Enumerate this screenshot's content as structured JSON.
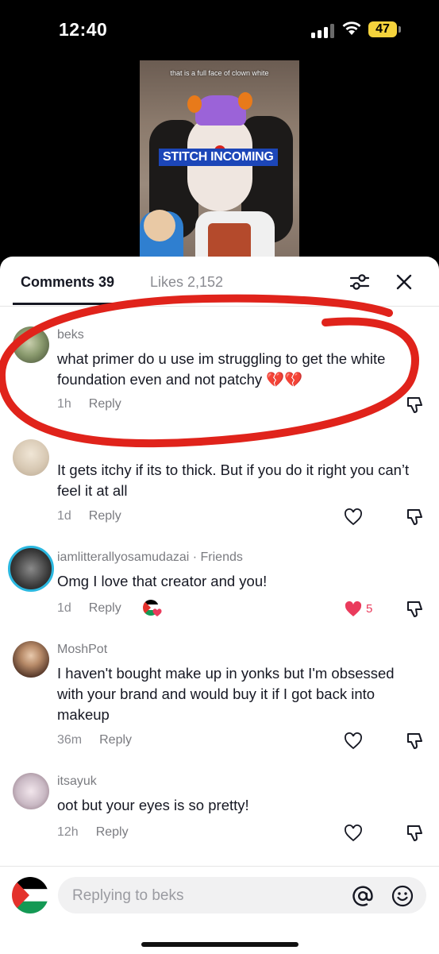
{
  "status_bar": {
    "time": "12:40",
    "battery": "47",
    "battery_color": "#f5d33c"
  },
  "video": {
    "caption": "that is a full face of clown white",
    "banner": "STITCH INCOMING"
  },
  "tabs": {
    "comments": "Comments 39",
    "likes": "Likes 2,152"
  },
  "comments": [
    {
      "user": "beks",
      "text": "what primer do u use im struggling to get the white foundation even and not patchy 💔💔",
      "time": "1h",
      "reply": "Reply",
      "avatar_color": "#8a9a6e"
    },
    {
      "user": "",
      "text": "It gets itchy if its to thick. But if you do it right you can’t feel it at all",
      "time": "1d",
      "reply": "Reply",
      "avatar_color": "#d8c9b4"
    },
    {
      "user": "iamlitterallyosamudazai · Friends",
      "text": "Omg I love that creator and you!",
      "time": "1d",
      "reply": "Reply",
      "likes": "5",
      "liked": true,
      "avatar_color": "#3a3a3a"
    },
    {
      "user": "MoshPot",
      "text": "I haven't bought make up in yonks but I'm obsessed with your brand and would buy it if I got back into makeup",
      "time": "36m",
      "reply": "Reply",
      "avatar_color": "#6b4a3a"
    },
    {
      "user": "itsayuk",
      "text": "oot but your eyes is so pretty!",
      "time": "12h",
      "reply": "Reply",
      "avatar_color": "#c9b9c4"
    }
  ],
  "reply_bar": {
    "placeholder": "Replying to beks"
  },
  "colors": {
    "accent_like": "#ea3b5c",
    "annotation_red": "#e0231b",
    "text": "#161823",
    "muted": "#8a8b91"
  },
  "icons": [
    "signal-icon",
    "wifi-icon",
    "filter-icon",
    "close-icon",
    "heart-icon",
    "dislike-icon",
    "at-icon",
    "emoji-icon",
    "palestine-flag-icon"
  ]
}
